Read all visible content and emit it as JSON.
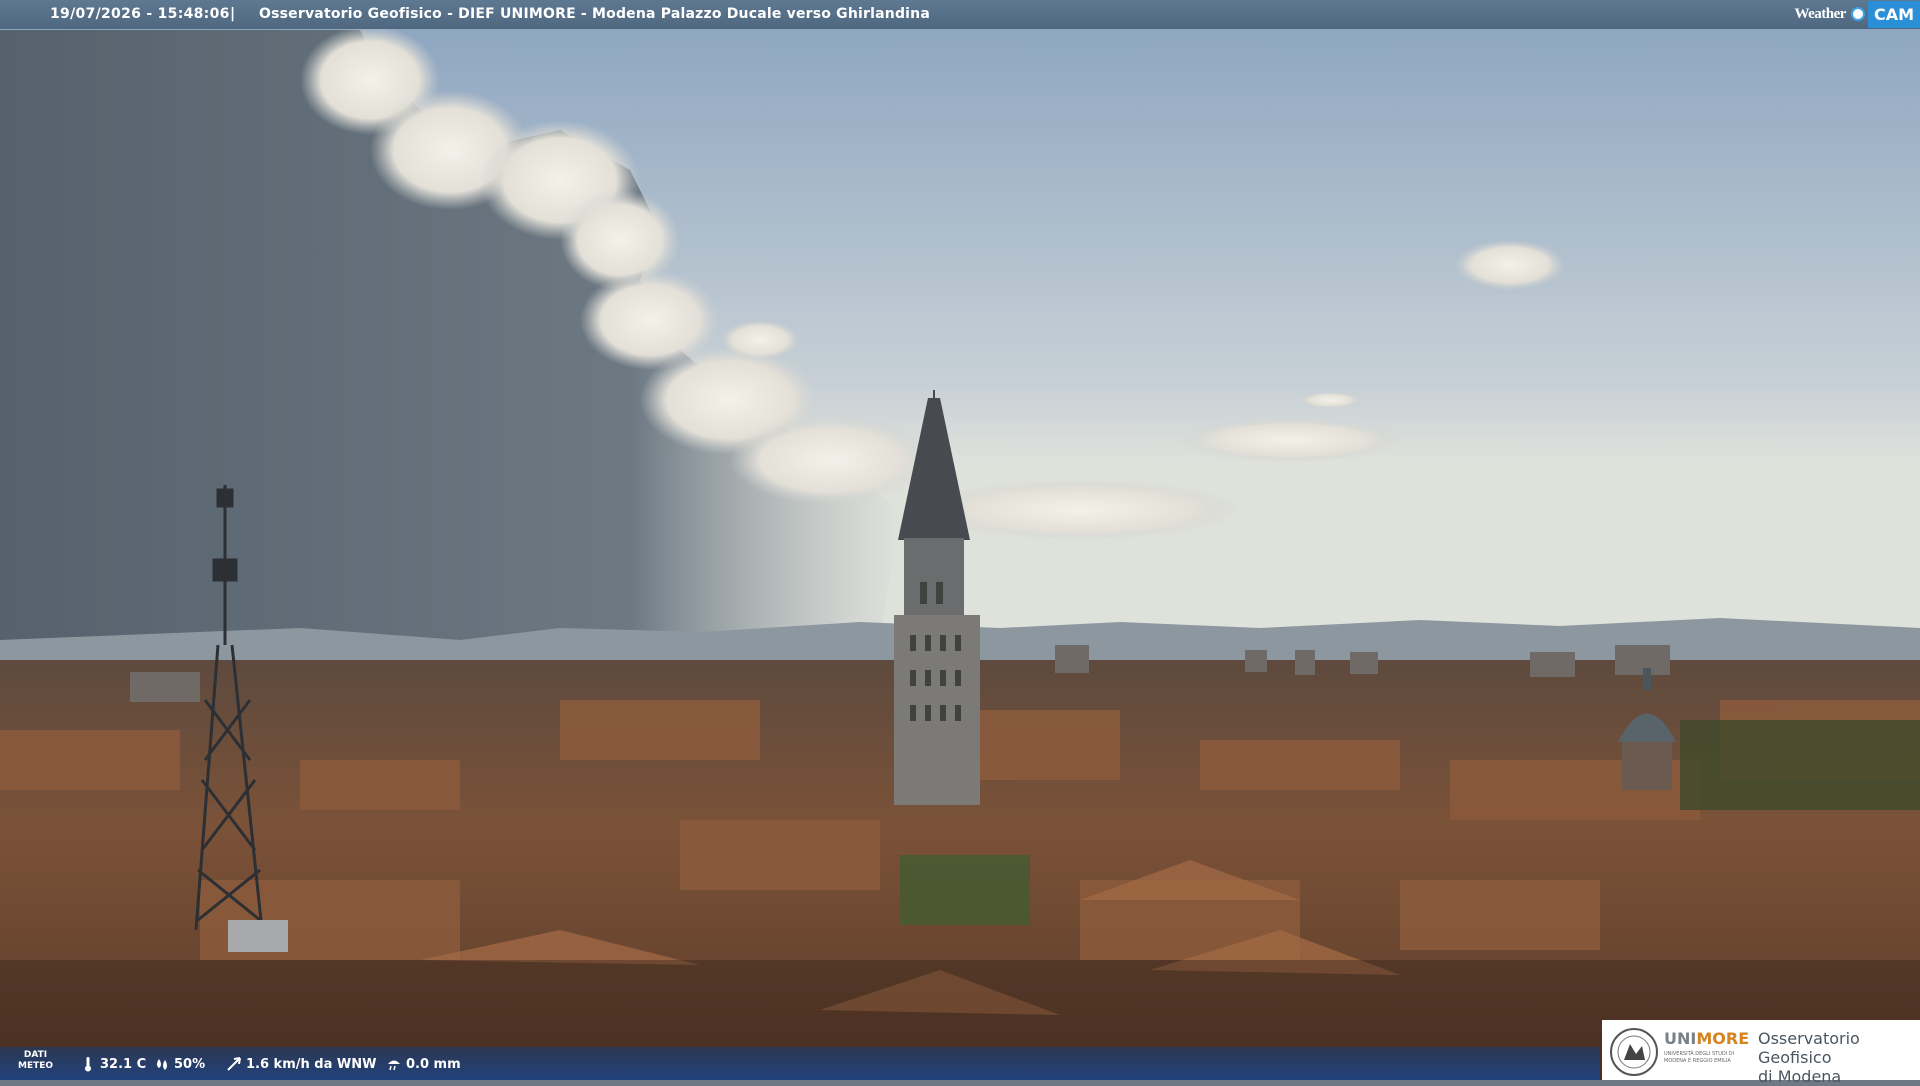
{
  "overlay": {
    "timestamp": "19/07/2026 - 15:48:06",
    "separator": "|",
    "location": "Osservatorio Geofisico - DIEF UNIMORE - Modena Palazzo Ducale verso Ghirlandina",
    "brand_weather": "Weather",
    "brand_cam": "CAM"
  },
  "weather_data": {
    "label_line1": "DATI",
    "label_line2": "METEO",
    "temperature": "32.1 C",
    "humidity": "50%",
    "wind": "1.6 km/h da WNW",
    "rain": "0.0 mm"
  },
  "logo": {
    "uni_prefix": "UNI",
    "uni_suffix": "MORE",
    "uni_sub": "UNIVERSITÀ DEGLI STUDI DI MODENA E REGGIO EMILIA",
    "obs_line1": "Osservatorio Geofisico",
    "obs_line2": "di Modena"
  },
  "colors": {
    "sky_top": "#8fa7c2",
    "sky_bottom": "#d9dcd6",
    "storm": "#5a6874",
    "roof": "#7a5038",
    "accent_blue": "#2b8fd8",
    "unimore_orange": "#d6821e"
  }
}
